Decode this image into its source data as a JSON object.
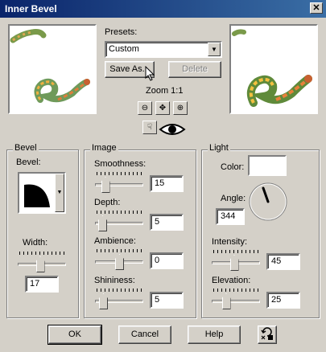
{
  "window": {
    "title": "Inner Bevel",
    "close_glyph": "✕"
  },
  "presets": {
    "label": "Presets:",
    "selected": "Custom",
    "save_as": "Save As...",
    "delete": "Delete"
  },
  "zoom": {
    "label": "Zoom 1:1"
  },
  "bevel": {
    "group_title": "Bevel",
    "bevel_label": "Bevel:",
    "width_label": "Width:",
    "width_value": "17",
    "width_slider": 0.45
  },
  "image": {
    "group_title": "Image",
    "smoothness_label": "Smoothness:",
    "smoothness_value": "15",
    "smoothness_slider": 0.15,
    "depth_label": "Depth:",
    "depth_value": "5",
    "depth_slider": 0.08,
    "ambience_label": "Ambience:",
    "ambience_value": "0",
    "ambience_slider": 0.5,
    "shininess_label": "Shininess:",
    "shininess_value": "5",
    "shininess_slider": 0.1
  },
  "light": {
    "group_title": "Light",
    "color_label": "Color:",
    "color_value": "#ffffff",
    "angle_label": "Angle:",
    "angle_value": "344",
    "intensity_label": "Intensity:",
    "intensity_value": "45",
    "intensity_slider": 0.45,
    "elevation_label": "Elevation:",
    "elevation_value": "25",
    "elevation_slider": 0.25
  },
  "footer": {
    "ok": "OK",
    "cancel": "Cancel",
    "help": "Help"
  },
  "colors": {
    "titlebar_start": "#0a246a",
    "titlebar_end": "#3a6ea5",
    "face": "#d4d0c8"
  }
}
